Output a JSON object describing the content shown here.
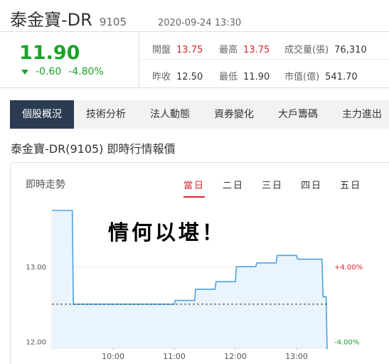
{
  "header": {
    "name": "泰金寶-DR",
    "code": "9105",
    "datetime": "2020-09-24 13:30"
  },
  "quote": {
    "price": "11.90",
    "change": "-0.60",
    "change_pct": "-4.80%",
    "colors": {
      "up": "#e0242f",
      "down": "#1aa32a"
    },
    "stats": [
      {
        "label": "開盤",
        "value": "13.75",
        "color": "red"
      },
      {
        "label": "最高",
        "value": "13.75",
        "color": "red"
      },
      {
        "label": "成交量(張)",
        "value": "76,310",
        "color": ""
      },
      {
        "label": "昨收",
        "value": "12.50",
        "color": ""
      },
      {
        "label": "最低",
        "value": "11.90",
        "color": ""
      },
      {
        "label": "市值(億)",
        "value": "541.70",
        "color": ""
      }
    ]
  },
  "tabs": [
    "個股概況",
    "技術分析",
    "法人動態",
    "資券變化",
    "大戶籌碼",
    "主力進出"
  ],
  "active_tab": "個股概況",
  "section_title": "泰金寶-DR(9105) 即時行情報價",
  "chart_card": {
    "label": "即時走勢",
    "ranges": [
      "當日",
      "二日",
      "三日",
      "四日",
      "五日"
    ],
    "active_range": "當日",
    "overlay_text": "情何以堪！"
  },
  "chart_data": {
    "type": "area",
    "title": "",
    "xlabel": "",
    "ylabel": "",
    "x_ticks": [
      "10:00",
      "11:00",
      "12:00",
      "13:00"
    ],
    "y_ticks_left": [
      "13.00",
      "12.00"
    ],
    "y_ticks_right": [
      "+4.00%",
      "-4.00%"
    ],
    "reference_price": 12.5,
    "x_range": [
      "09:00",
      "13:30"
    ],
    "ylim": [
      11.93,
      13.75
    ],
    "series": [
      {
        "x": [
          "09:00",
          "09:20",
          "09:21",
          "10:00",
          "10:30",
          "11:00",
          "11:01",
          "11:20",
          "11:21",
          "11:40",
          "11:41",
          "12:00",
          "12:01",
          "12:20",
          "12:21",
          "12:40",
          "12:41",
          "13:00",
          "13:01",
          "13:20",
          "13:21",
          "13:25",
          "13:26",
          "13:29",
          "13:30"
        ],
        "values": [
          13.75,
          13.75,
          12.5,
          12.5,
          12.5,
          12.5,
          12.55,
          12.55,
          12.7,
          12.7,
          12.8,
          12.8,
          13.0,
          13.0,
          13.05,
          13.05,
          13.15,
          13.15,
          13.1,
          13.1,
          13.1,
          13.1,
          12.6,
          12.6,
          11.9
        ]
      }
    ],
    "grid": "horizontal",
    "colors": {
      "line": "#4aa3e0",
      "fill": "#eaf4fc",
      "grid": "#e6e6e6",
      "reference": "#333333",
      "pct_up": "#e0242f",
      "pct_down": "#1aa32a"
    }
  }
}
